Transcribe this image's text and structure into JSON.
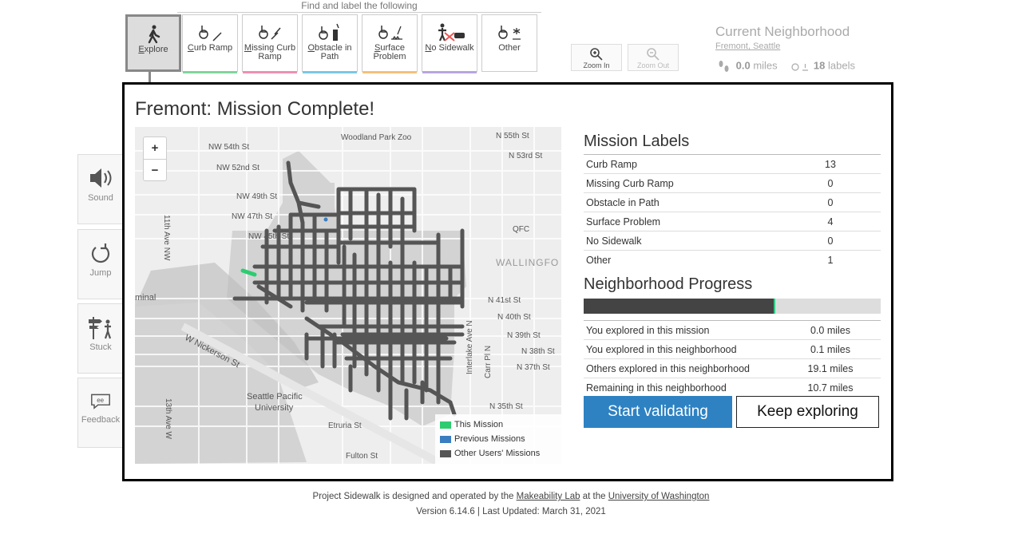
{
  "toolbar": {
    "heading": "Find and label the following",
    "tools": [
      {
        "key": "E",
        "rest": "xplore",
        "color": ""
      },
      {
        "key": "C",
        "rest": "urb Ramp",
        "color": "#7fd59a"
      },
      {
        "key": "M",
        "rest": "issing Curb Ramp",
        "color": "#f08fb4"
      },
      {
        "key": "O",
        "rest": "bstacle in Path",
        "color": "#7cc7e6"
      },
      {
        "key": "S",
        "rest": "urface Problem",
        "color": "#f6c07a"
      },
      {
        "key": "N",
        "rest": "o Sidewalk",
        "color": "#b7a6e0"
      },
      {
        "key": "",
        "rest": "Other",
        "color": ""
      }
    ],
    "zoom_in": "Zoom In",
    "zoom_out": "Zoom Out"
  },
  "status": {
    "title": "Current Neighborhood",
    "neighborhood": "Fremont, Seattle",
    "miles_value": "0.0",
    "miles_unit": "miles",
    "labels_value": "18",
    "labels_unit": "labels"
  },
  "sidebar": {
    "sound": "Sound",
    "jump": "Jump",
    "stuck": "Stuck",
    "feedback": "Feedback"
  },
  "modal": {
    "title": "Fremont: Mission Complete!",
    "map": {
      "labels": {
        "zoo": "Woodland Park Zoo",
        "n54": "NW 54th St",
        "n52": "NW 52nd St",
        "n49": "NW 49th St",
        "n47": "NW 47th St",
        "n45": "NW 45th St",
        "ave11": "11th Ave NW",
        "n55e": "N 55th St",
        "n53e": "N 53rd St",
        "qfc": "QFC",
        "wall": "WALLINGFO",
        "n41": "N 41st St",
        "n40": "N 40th St",
        "n39": "N 39th St",
        "n38": "N 38th St",
        "n37": "N 37th St",
        "n35": "N 35th St",
        "nick": "W Nickerson St",
        "spu1": "Seattle Pacific",
        "spu2": "University",
        "etruria": "Etruria St",
        "fulton": "Fulton St",
        "ave13": "13th Ave W",
        "inter": "Interlake Ave N",
        "carr": "Carr Pl N",
        "minal": "minal"
      },
      "zoom_plus": "+",
      "zoom_minus": "−",
      "legend": [
        {
          "label": "This Mission",
          "color": "#2ecc71"
        },
        {
          "label": "Previous Missions",
          "color": "#3a7dc0"
        },
        {
          "label": "Other Users' Missions",
          "color": "#555555"
        }
      ]
    },
    "mission_labels": {
      "heading": "Mission Labels",
      "rows": [
        {
          "label": "Curb Ramp",
          "value": "13"
        },
        {
          "label": "Missing Curb Ramp",
          "value": "0"
        },
        {
          "label": "Obstacle in Path",
          "value": "0"
        },
        {
          "label": "Surface Problem",
          "value": "4"
        },
        {
          "label": "No Sidewalk",
          "value": "0"
        },
        {
          "label": "Other",
          "value": "1"
        }
      ]
    },
    "progress": {
      "heading": "Neighborhood Progress",
      "fraction": 0.64,
      "rows": [
        {
          "label": "You explored in this mission",
          "value": "0.0 miles"
        },
        {
          "label": "You explored in this neighborhood",
          "value": "0.1 miles"
        },
        {
          "label": "Others explored in this neighborhood",
          "value": "19.1 miles"
        },
        {
          "label": "Remaining in this neighborhood",
          "value": "10.7 miles"
        }
      ]
    },
    "buttons": {
      "validate": "Start validating",
      "explore": "Keep exploring"
    }
  },
  "footer": {
    "line1_a": "Project Sidewalk is designed and operated by the ",
    "lab": "Makeability Lab",
    "line1_b": " at the ",
    "uni": "University of Washington",
    "line2": "Version 6.14.6 | Last Updated: March 31, 2021"
  }
}
